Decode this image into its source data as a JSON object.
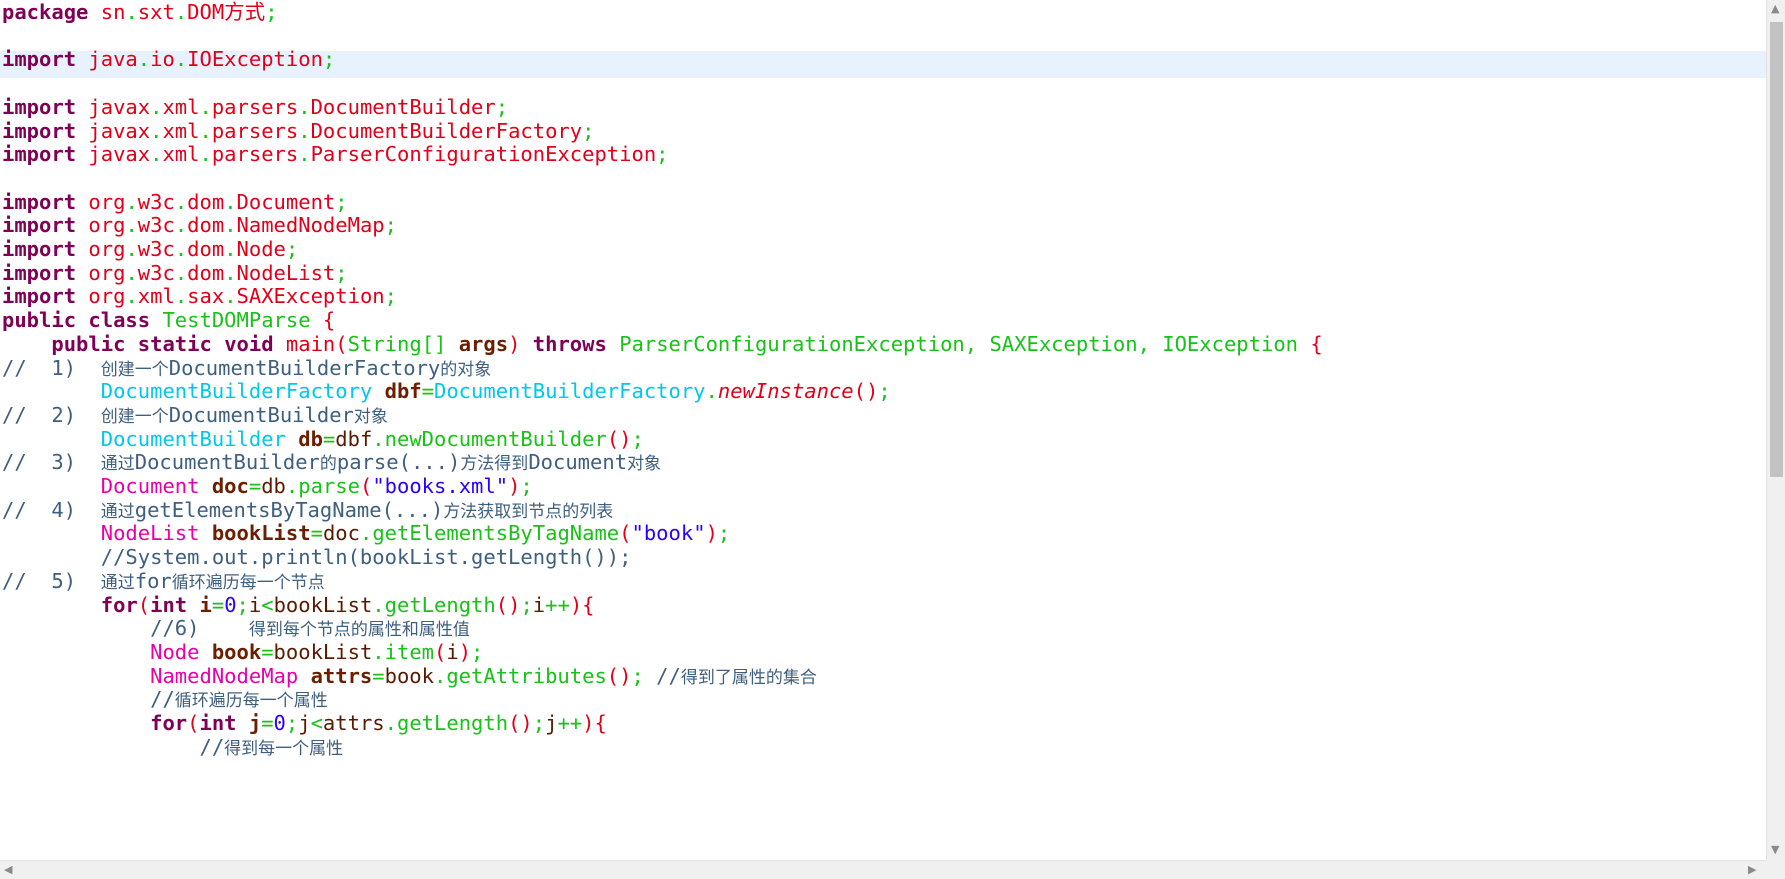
{
  "editor": {
    "language": "java",
    "highlighted_line": 2,
    "lines": [
      {
        "package": "package",
        "name": "sn.sxt.DOM方式;"
      },
      {},
      {
        "kw": "import",
        "path": "java.io.IOException;"
      },
      {},
      {
        "kw": "import",
        "path": "javax.xml.parsers.DocumentBuilder;"
      },
      {
        "kw": "import",
        "path": "javax.xml.parsers.DocumentBuilderFactory;"
      },
      {
        "kw": "import",
        "path": "javax.xml.parsers.ParserConfigurationException;"
      },
      {},
      {
        "kw": "import",
        "path": "org.w3c.dom.Document;"
      },
      {
        "kw": "import",
        "path": "org.w3c.dom.NamedNodeMap;"
      },
      {
        "kw": "import",
        "path": "org.w3c.dom.Node;"
      },
      {
        "kw": "import",
        "path": "org.w3c.dom.NodeList;"
      },
      {
        "kw": "import",
        "path": "org.xml.sax.SAXException;"
      },
      {
        "text": "public class TestDOMParse {"
      },
      {
        "text": "    public static void main(String[] args) throws ParserConfigurationException, SAXException, IOException {"
      },
      {
        "text": "//  1)  创建一个DocumentBuilderFactory的对象"
      },
      {
        "text": "        DocumentBuilderFactory dbf=DocumentBuilderFactory.newInstance();"
      },
      {
        "text": "//  2)  创建一个DocumentBuilder对象"
      },
      {
        "text": "        DocumentBuilder db=dbf.newDocumentBuilder();"
      },
      {
        "text": "//  3)  通过DocumentBuilder的parse(...)方法得到Document对象"
      },
      {
        "text": "        Document doc=db.parse(\"books.xml\");"
      },
      {
        "text": "//  4)  通过getElementsByTagName(...)方法获取到节点的列表"
      },
      {
        "text": "        NodeList bookList=doc.getElementsByTagName(\"book\");"
      },
      {
        "text": "        //System.out.println(bookList.getLength());"
      },
      {
        "text": "//  5)  通过for循环遍历每一个节点"
      },
      {
        "text": "        for(int i=0;i<bookList.getLength();i++){"
      },
      {
        "text": "            //6)    得到每个节点的属性和属性值"
      },
      {
        "text": "            Node book=bookList.item(i);"
      },
      {
        "text": "            NamedNodeMap attrs=book.getAttributes(); //得到了属性的集合"
      },
      {
        "text": "            //循环遍历每一个属性"
      },
      {
        "text": "            for(int j=0;j<attrs.getLength();j++){"
      },
      {
        "text": "                //得到每一个属性"
      }
    ]
  },
  "scrollbars": {
    "vertical_up": "▲",
    "vertical_down": "▼",
    "horizontal_left": "◀",
    "horizontal_right": "▶"
  }
}
